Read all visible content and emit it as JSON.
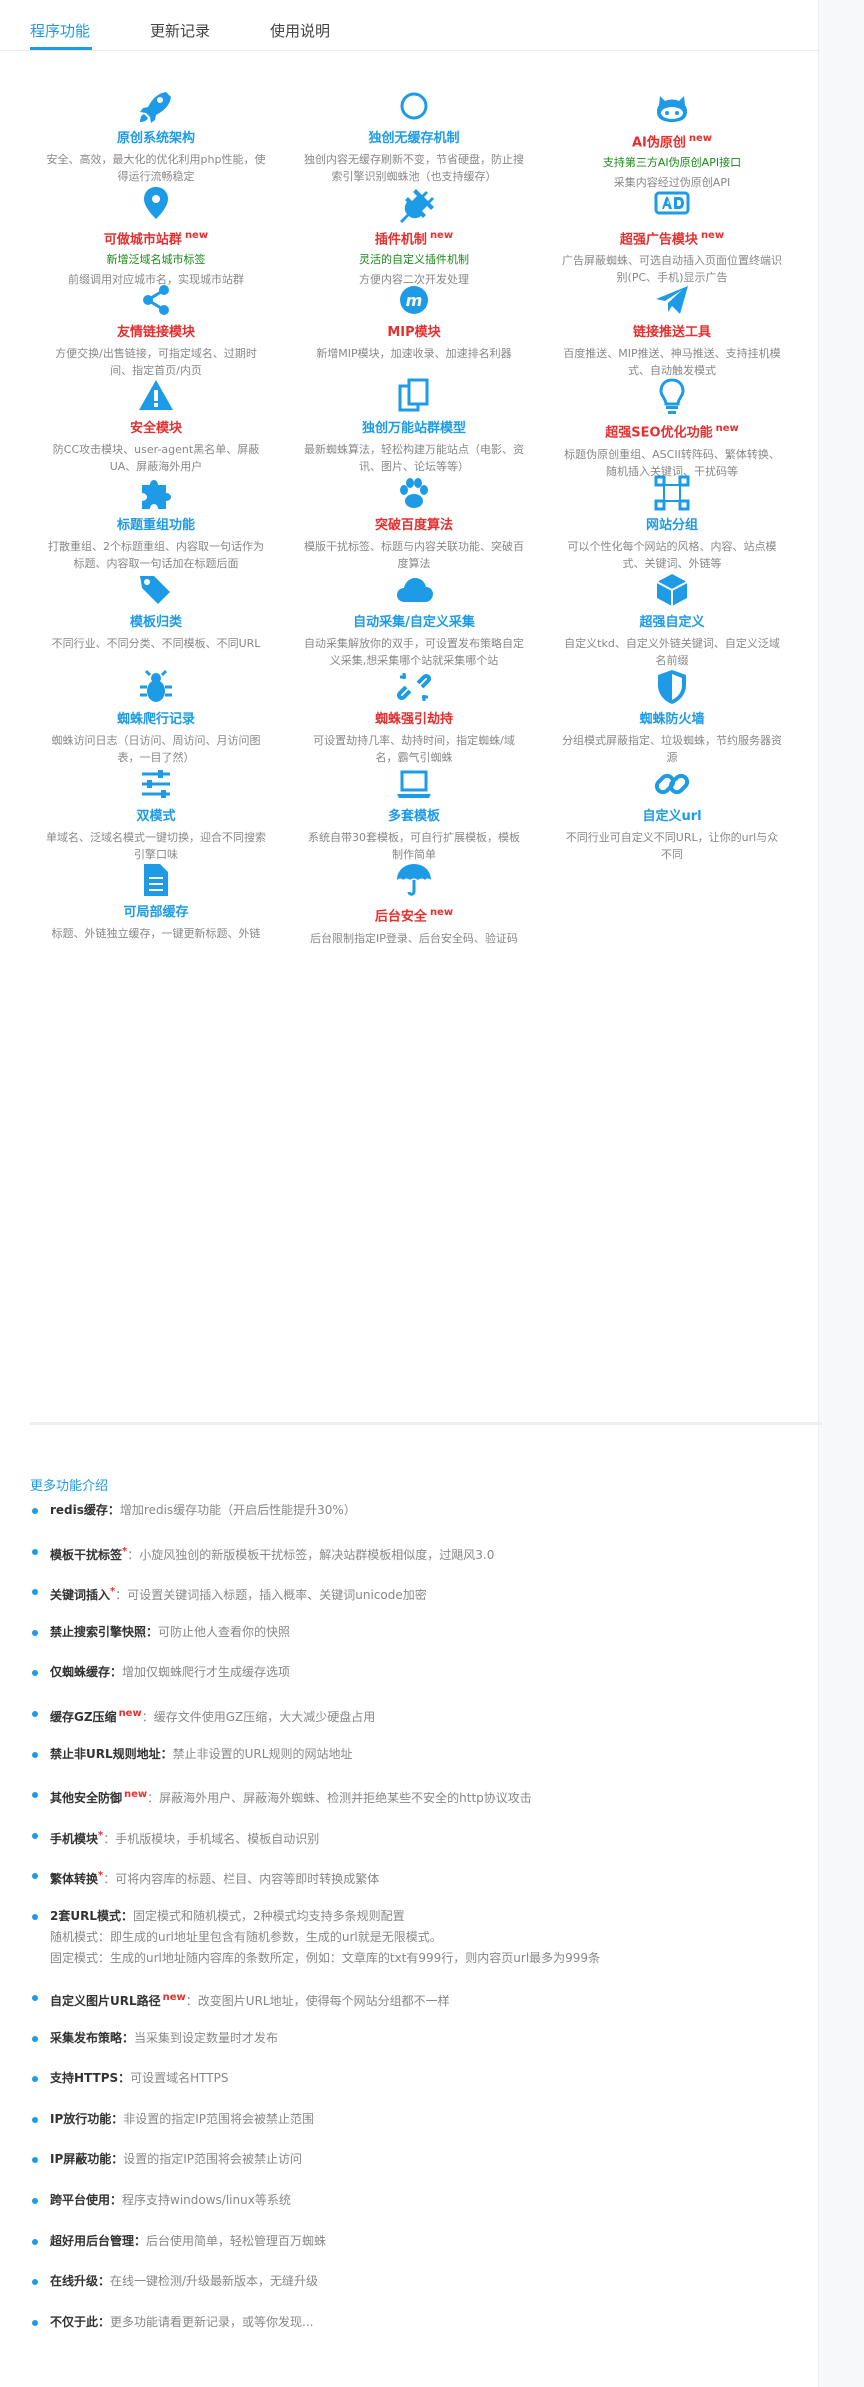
{
  "tabs": [
    {
      "label": "程序功能",
      "active": true
    },
    {
      "label": "更新记录",
      "active": false
    },
    {
      "label": "使用说明",
      "active": false
    }
  ],
  "colors": {
    "accent": "#1e9be6",
    "red": "#e53030",
    "green": "#1a8a1a"
  },
  "features": [
    {
      "icon": "rocket-icon",
      "title": "原创系统架构",
      "color": "blue",
      "new": "",
      "sub": "",
      "desc": "安全、高效，最大化的优化利用php性能，使得运行流畅稳定"
    },
    {
      "icon": "circle-icon",
      "title": "独创无缓存机制",
      "color": "blue",
      "new": "",
      "sub": "",
      "desc": "独创内容无缓存刷新不变，节省硬盘，防止搜索引擎识别蜘蛛池（也支持缓存）"
    },
    {
      "icon": "github-cat-icon",
      "title": "AI伪原创",
      "color": "red",
      "new": "new",
      "sub": "支持第三方AI伪原创API接口",
      "desc": "采集内容经过伪原创API"
    },
    {
      "icon": "map-pin-icon",
      "title": "可做城市站群",
      "color": "red",
      "new": "new",
      "sub": "新增泛域名城市标签",
      "desc": "前缀调用对应城市名，实现城市站群"
    },
    {
      "icon": "plug-icon",
      "title": "插件机制",
      "color": "red",
      "new": "new",
      "sub": "灵活的自定义插件机制",
      "desc": "方便内容二次开发处理"
    },
    {
      "icon": "ad-icon",
      "title": "超强广告模块",
      "color": "red",
      "new": "new",
      "sub": "",
      "desc": "广告屏蔽蜘蛛、可选自动插入页面位置终端识别(PC、手机)显示广告"
    },
    {
      "icon": "share-icon",
      "title": "友情链接模块",
      "color": "red",
      "new": "",
      "sub": "",
      "desc": "方便交换/出售链接，可指定域名、过期时间、指定首页/内页"
    },
    {
      "icon": "mip-icon",
      "title": "MIP模块",
      "color": "red",
      "new": "",
      "sub": "",
      "desc": "新增MIP模块，加速收录、加速排名利器"
    },
    {
      "icon": "paper-plane-icon",
      "title": "链接推送工具",
      "color": "red",
      "new": "",
      "sub": "",
      "desc": "百度推送、MIP推送、神马推送、支持挂机模式、自动触发模式"
    },
    {
      "icon": "warning-icon",
      "title": "安全模块",
      "color": "red",
      "new": "",
      "sub": "",
      "desc": "防CC攻击模块、user-agent黑名单、屏蔽UA、屏蔽海外用户"
    },
    {
      "icon": "copy-icon",
      "title": "独创万能站群模型",
      "color": "blue",
      "new": "",
      "sub": "",
      "desc": "最新蜘蛛算法，轻松构建万能站点（电影、资讯、图片、论坛等等）"
    },
    {
      "icon": "lightbulb-icon",
      "title": "超强SEO优化功能",
      "color": "red",
      "new": "new",
      "sub": "",
      "desc": "标题伪原创重组、ASCII转阵码、繁体转换、随机插入关键词、干扰码等"
    },
    {
      "icon": "puzzle-icon",
      "title": "标题重组功能",
      "color": "blue",
      "new": "",
      "sub": "",
      "desc": "打散重组、2个标题重组、内容取一句话作为标题、内容取一句话加在标题后面"
    },
    {
      "icon": "paw-icon",
      "title": "突破百度算法",
      "color": "red",
      "new": "",
      "sub": "",
      "desc": "模版干扰标签、标题与内容关联功能、突破百度算法"
    },
    {
      "icon": "grouping-icon",
      "title": "网站分组",
      "color": "blue",
      "new": "",
      "sub": "",
      "desc": "可以个性化每个网站的风格、内容、站点模式、关键词、外链等"
    },
    {
      "icon": "tags-icon",
      "title": "模板归类",
      "color": "blue",
      "new": "",
      "sub": "",
      "desc": "不同行业、不同分类、不同模板、不同URL"
    },
    {
      "icon": "cloud-icon",
      "title": "自动采集/自定义采集",
      "color": "blue",
      "new": "",
      "sub": "",
      "desc": "自动采集解放你的双手，可设置发布策略自定义采集,想采集哪个站就采集哪个站"
    },
    {
      "icon": "cube-icon",
      "title": "超强自定义",
      "color": "blue",
      "new": "",
      "sub": "",
      "desc": "自定义tkd、自定义外链关键词、自定义泛域名前缀"
    },
    {
      "icon": "bug-icon",
      "title": "蜘蛛爬行记录",
      "color": "blue",
      "new": "",
      "sub": "",
      "desc": "蜘蛛访问日志（日访问、周访问、月访问图表，一目了然）"
    },
    {
      "icon": "unlink-icon",
      "title": "蜘蛛强引劫持",
      "color": "red",
      "new": "",
      "sub": "",
      "desc": "可设置劫持几率、劫持时间，指定蜘蛛/域名，霸气引蜘蛛"
    },
    {
      "icon": "shield-icon",
      "title": "蜘蛛防火墙",
      "color": "blue",
      "new": "",
      "sub": "",
      "desc": "分组模式屏蔽指定、垃圾蜘蛛，节约服务器资源"
    },
    {
      "icon": "sliders-icon",
      "title": "双模式",
      "color": "blue",
      "new": "",
      "sub": "",
      "desc": "单域名、泛域名模式一键切换，迎合不同搜索引擎口味"
    },
    {
      "icon": "laptop-icon",
      "title": "多套模板",
      "color": "blue",
      "new": "",
      "sub": "",
      "desc": "系统自带30套模板，可自行扩展模板，模板制作简单"
    },
    {
      "icon": "link-icon",
      "title": "自定义url",
      "color": "blue",
      "new": "",
      "sub": "",
      "desc": "不同行业可自定义不同URL，让你的url与众不同"
    },
    {
      "icon": "file-icon",
      "title": "可局部缓存",
      "color": "blue",
      "new": "",
      "sub": "",
      "desc": "标题、外链独立缓存，一键更新标题、外链"
    },
    {
      "icon": "umbrella-icon",
      "title": "后台安全",
      "color": "red",
      "new": "new",
      "sub": "",
      "desc": "后台限制指定IP登录、后台安全码、验证码"
    }
  ],
  "more": {
    "title": "更多功能介绍",
    "items": [
      {
        "name": "redis缓存：",
        "star": "",
        "new": "",
        "desc": "增加redis缓存功能（开启后性能提升30%）"
      },
      {
        "name": "模板干扰标签",
        "star": "*",
        "new": "",
        "desc": "：小旋风独创的新版模板干扰标签，解决站群模板相似度，过飓风3.0"
      },
      {
        "name": "关键词插入",
        "star": "*",
        "new": "",
        "desc": "：可设置关键词插入标题，插入概率、关键词unicode加密"
      },
      {
        "name": "禁止搜索引擎快照：",
        "star": "",
        "new": "",
        "desc": "可防止他人查看你的快照"
      },
      {
        "name": "仅蜘蛛缓存：",
        "star": "",
        "new": "",
        "desc": "增加仅蜘蛛爬行才生成缓存选项"
      },
      {
        "name": "缓存GZ压缩",
        "star": "",
        "new": "new",
        "desc": "：缓存文件使用GZ压缩，大大减少硬盘占用"
      },
      {
        "name": "禁止非URL规则地址：",
        "star": "",
        "new": "",
        "desc": "禁止非设置的URL规则的网站地址"
      },
      {
        "name": "其他安全防御",
        "star": "",
        "new": "new",
        "desc": "：屏蔽海外用户、屏蔽海外蜘蛛、检测并拒绝某些不安全的http协议攻击"
      },
      {
        "name": "手机模块",
        "star": "*",
        "new": "",
        "desc": "：手机版模块，手机域名、模板自动识别"
      },
      {
        "name": "繁体转换",
        "star": "*",
        "new": "",
        "desc": "：可将内容库的标题、栏目、内容等即时转换成繁体"
      },
      {
        "name": "2套URL模式：",
        "star": "",
        "new": "",
        "desc": "固定模式和随机模式，2种模式均支持多条规则配置",
        "extra": [
          "随机模式：即生成的url地址里包含有随机参数，生成的url就是无限模式。",
          "固定模式：生成的url地址随内容库的条数所定，例如：文章库的txt有999行，则内容页url最多为999条"
        ]
      },
      {
        "name": "自定义图片URL路径",
        "star": "",
        "new": "new",
        "desc": "：改变图片URL地址，使得每个网站分组都不一样"
      },
      {
        "name": "采集发布策略：",
        "star": "",
        "new": "",
        "desc": "当采集到设定数量时才发布"
      },
      {
        "name": "支持HTTPS：",
        "star": "",
        "new": "",
        "desc": "可设置域名HTTPS"
      },
      {
        "name": "IP放行功能：",
        "star": "",
        "new": "",
        "desc": "非设置的指定IP范围将会被禁止范围"
      },
      {
        "name": "IP屏蔽功能：",
        "star": "",
        "new": "",
        "desc": "设置的指定IP范围将会被禁止访问"
      },
      {
        "name": "跨平台使用：",
        "star": "",
        "new": "",
        "desc": "程序支持windows/linux等系统"
      },
      {
        "name": "超好用后台管理：",
        "star": "",
        "new": "",
        "desc": "后台使用简单，轻松管理百万蜘蛛"
      },
      {
        "name": "在线升级：",
        "star": "",
        "new": "",
        "desc": "在线一键检测/升级最新版本，无缝升级"
      },
      {
        "name": "不仅于此：",
        "star": "",
        "new": "",
        "desc": "更多功能请看更新记录，或等你发现..."
      }
    ]
  }
}
